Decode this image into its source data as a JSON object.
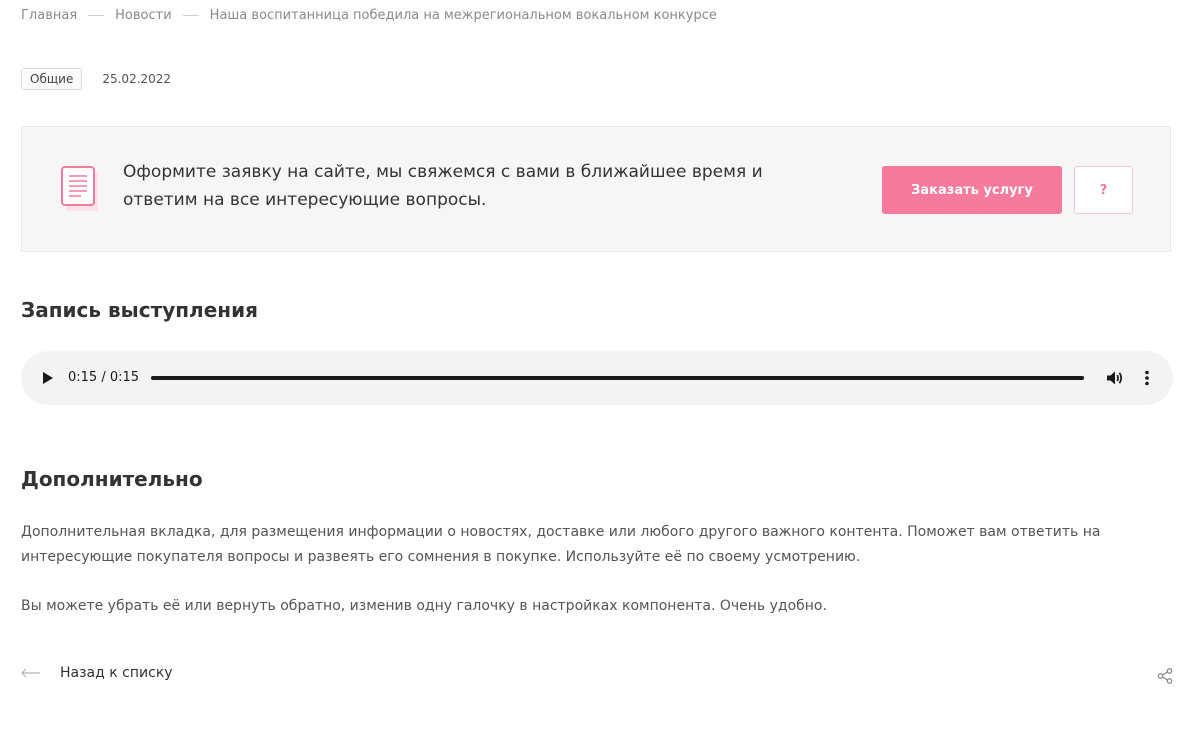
{
  "breadcrumbs": [
    {
      "label": "Главная"
    },
    {
      "label": "Новости"
    },
    {
      "label": "Наша воспитанница победила на межрегиональном вокальном конкурсе"
    }
  ],
  "meta": {
    "tag": "Общие",
    "date": "25.02.2022"
  },
  "banner": {
    "icon": "document-icon",
    "text": "Оформите заявку на сайте, мы свяжемся с вами в ближайшее время и ответим на все интересующие вопросы.",
    "order_button": "Заказать услугу",
    "help_button": "?"
  },
  "record_section": {
    "title": "Запись выступления",
    "audio": {
      "time": "0:15 / 0:15",
      "progress": 1.0,
      "icons": [
        "play-icon",
        "volume-icon",
        "more-vertical-icon"
      ]
    }
  },
  "extra_section": {
    "title": "Дополнительно",
    "paragraph_1": "Дополнительная вкладка, для размещения информации о новостях, доставке или любого другого важного контента. Поможет вам ответить на интересующие покупателя вопросы и развеять его сомнения в покупке. Используйте её по своему усмотрению.",
    "paragraph_2": "Вы можете убрать её или вернуть обратно, изменив одну галочку в настройках компонента. Очень удобно."
  },
  "footer": {
    "back_label": "Назад к списку",
    "share_icon": "share-icon"
  },
  "colors": {
    "accent": "#f57a9b",
    "banner_bg": "#f6f6f6",
    "player_bg": "#f1f3f4"
  }
}
